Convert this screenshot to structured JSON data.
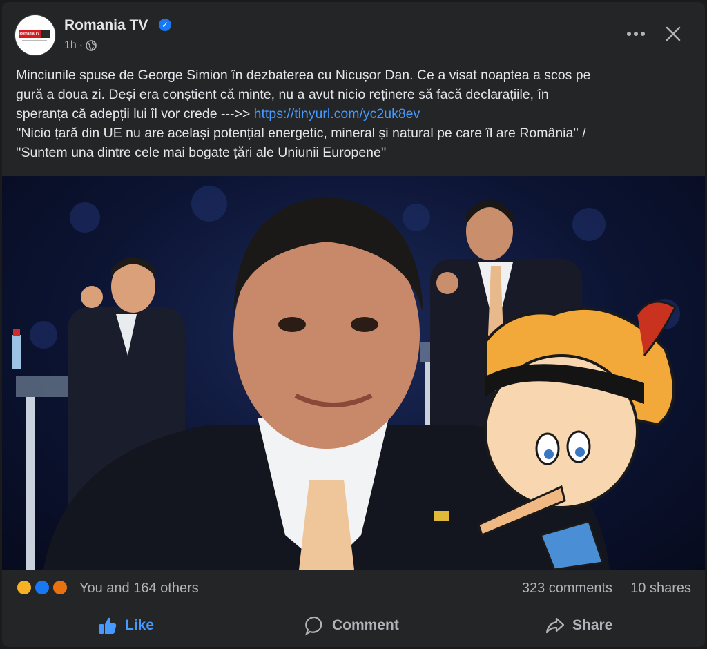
{
  "post": {
    "page_name": "Romania TV",
    "avatar_logo_text": "România TV",
    "timestamp": "1h",
    "separator": "·",
    "text_lines": [
      "Minciunile spuse de George Simion în dezbaterea cu Nicușor Dan. Ce a visat noaptea a scos pe",
      "gură a doua zi. Deși era conștient că minte, nu a avut nicio reținere să facă declarațiile, în",
      "speranța că adepții lui îl vor crede --->> "
    ],
    "link": "https://tinyurl.com/yc2uk8ev",
    "quote_lines": [
      "''Nicio țară din UE nu are același potențial energetic, mineral și natural pe care îl are România'' /",
      "''Suntem una dintre cele mai bogate țări ale Uniunii Europene''"
    ]
  },
  "reactions": {
    "icons": [
      "haha-icon",
      "like-icon",
      "angry-icon"
    ],
    "summary": "You and 164 others",
    "comments": "323 comments",
    "shares": "10 shares"
  },
  "actions": {
    "like": "Like",
    "comment": "Comment",
    "share": "Share"
  },
  "colors": {
    "background": "#242526",
    "text": "#e4e6eb",
    "secondary_text": "#b0b3b8",
    "link": "#4599ff",
    "verified": "#1877f2"
  }
}
